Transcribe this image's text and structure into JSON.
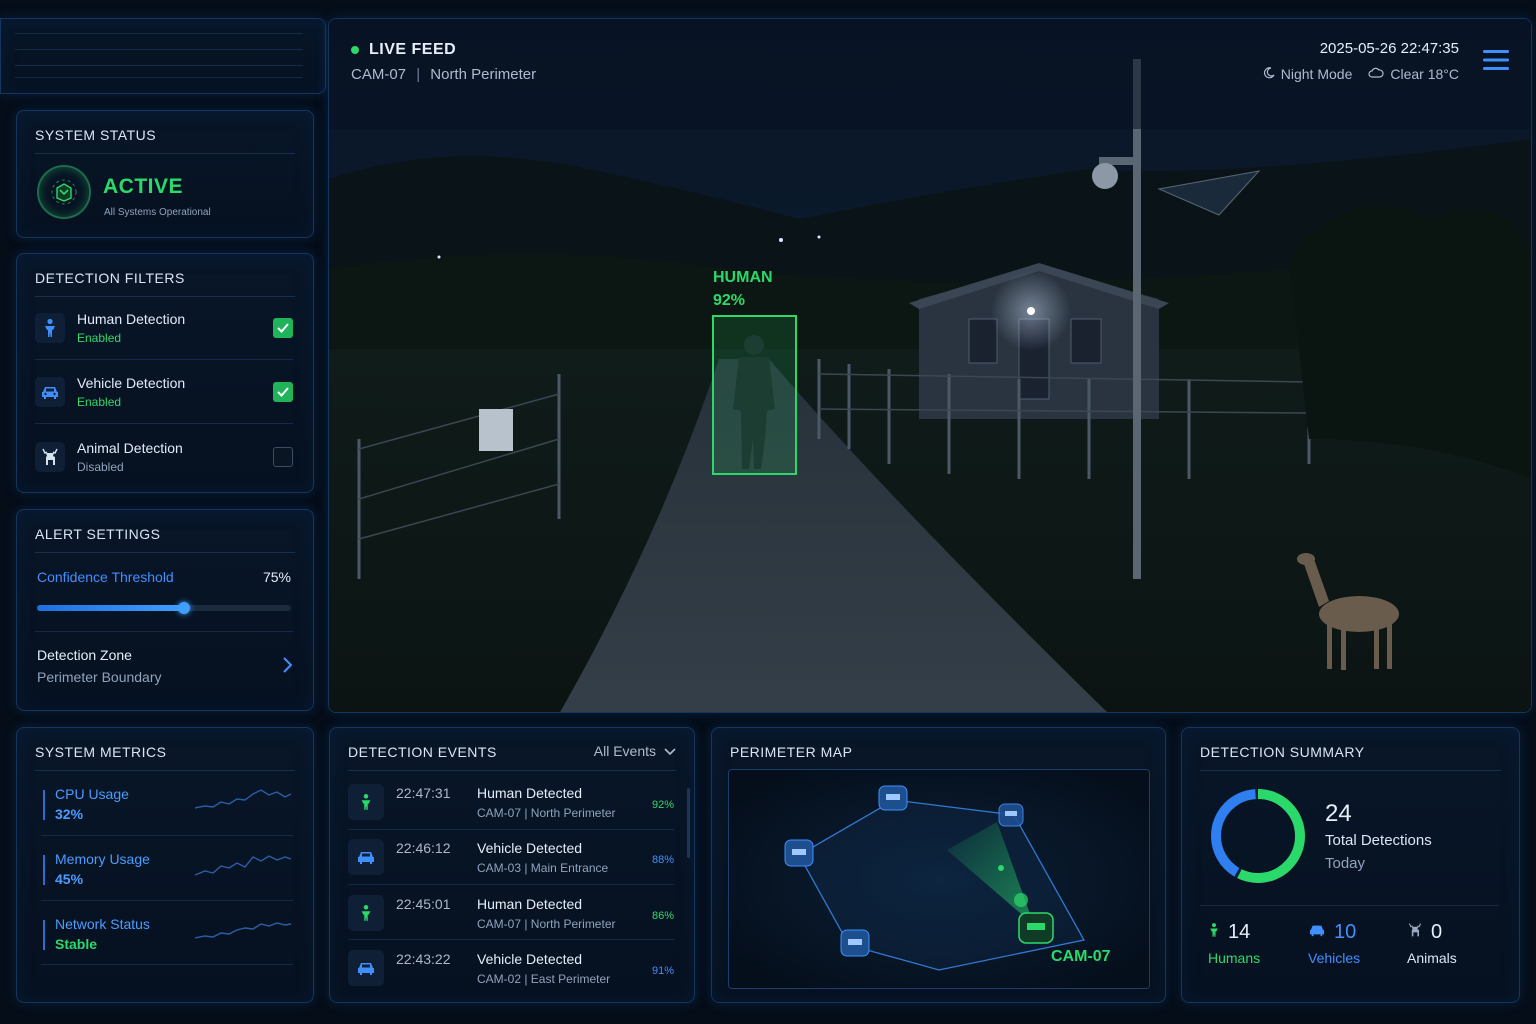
{
  "system_status": {
    "title": "SYSTEM STATUS",
    "state": "ACTIVE",
    "subtitle": "All Systems Operational"
  },
  "detection_filters": {
    "title": "DETECTION FILTERS",
    "items": [
      {
        "label": "Human Detection",
        "state": "Enabled",
        "checked": true,
        "icon": "person-icon"
      },
      {
        "label": "Vehicle Detection",
        "state": "Enabled",
        "checked": true,
        "icon": "car-icon"
      },
      {
        "label": "Animal Detection",
        "state": "Disabled",
        "checked": false,
        "icon": "deer-icon"
      }
    ]
  },
  "alert_settings": {
    "title": "ALERT SETTINGS",
    "threshold_label": "Confidence Threshold",
    "threshold_value": "75%",
    "threshold_fraction": 0.58,
    "zone_label": "Detection Zone",
    "zone_value": "Perimeter Boundary"
  },
  "feed": {
    "live_label": "LIVE FEED",
    "camera_id": "CAM-07",
    "camera_location": "North Perimeter",
    "datetime": "2025-05-26 22:47:35",
    "mode": "Night Mode",
    "weather": "Clear 18°C",
    "detection_label": "HUMAN",
    "detection_conf": "92%"
  },
  "system_metrics": {
    "title": "SYSTEM METRICS",
    "items": [
      {
        "label": "CPU Usage",
        "value": "32%"
      },
      {
        "label": "Memory Usage",
        "value": "45%"
      },
      {
        "label": "Network Status",
        "value": "Stable"
      }
    ]
  },
  "detection_events": {
    "title": "DETECTION EVENTS",
    "filter": "All Events",
    "items": [
      {
        "time": "22:47:31",
        "title": "Human Detected",
        "source": "CAM-07 | North Perimeter",
        "conf": "92%",
        "type": "human"
      },
      {
        "time": "22:46:12",
        "title": "Vehicle Detected",
        "source": "CAM-03 | Main Entrance",
        "conf": "88%",
        "type": "vehicle"
      },
      {
        "time": "22:45:01",
        "title": "Human Detected",
        "source": "CAM-07 | North Perimeter",
        "conf": "86%",
        "type": "human"
      },
      {
        "time": "22:43:22",
        "title": "Vehicle Detected",
        "source": "CAM-02 | East Perimeter",
        "conf": "91%",
        "type": "vehicle"
      }
    ]
  },
  "perimeter_map": {
    "title": "PERIMETER MAP",
    "active_camera": "CAM-07"
  },
  "detection_summary": {
    "title": "DETECTION SUMMARY",
    "total": "24",
    "total_label": "Total Detections",
    "period": "Today",
    "humans": {
      "count": "14",
      "label": "Humans"
    },
    "vehicles": {
      "count": "10",
      "label": "Vehicles"
    },
    "animals": {
      "count": "0",
      "label": "Animals"
    }
  },
  "colors": {
    "accent_blue": "#3f8fff",
    "accent_green": "#2bd96b",
    "background": "#050d18"
  }
}
